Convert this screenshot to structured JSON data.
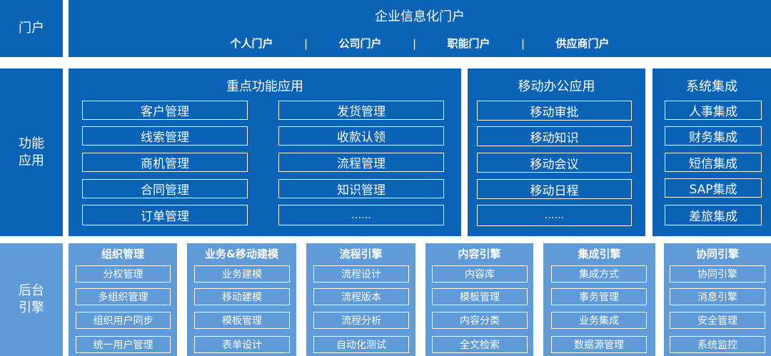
{
  "rows": {
    "portal": "门户",
    "function": "功能\n应用",
    "engine": "后台\n引擎"
  },
  "portal": {
    "title": "企业信息化门户",
    "links": [
      "个人门户",
      "公司门户",
      "职能门户",
      "供应商门户"
    ],
    "separator": "|"
  },
  "key_apps": {
    "title": "重点功能应用",
    "left": [
      "客户管理",
      "线索管理",
      "商机管理",
      "合同管理",
      "订单管理"
    ],
    "right": [
      "发货管理",
      "收款认领",
      "流程管理",
      "知识管理",
      "……"
    ]
  },
  "mobile": {
    "title": "移动办公应用",
    "items": [
      "移动审批",
      "移动知识",
      "移动会议",
      "移动日程",
      "……"
    ]
  },
  "integration": {
    "title": "系统集成",
    "items": [
      "人事集成",
      "财务集成",
      "短信集成",
      "SAP集成",
      "差旅集成"
    ]
  },
  "engines": [
    {
      "title": "组织管理",
      "items": [
        "分权管理",
        "多组织管理",
        "组织用户同步",
        "统一用户管理"
      ]
    },
    {
      "title": "业务&移动建模",
      "items": [
        "业务建模",
        "移动建模",
        "模板管理",
        "表单设计"
      ]
    },
    {
      "title": "流程引擎",
      "items": [
        "流程设计",
        "流程版本",
        "流程分析",
        "自动化测试"
      ]
    },
    {
      "title": "内容引擎",
      "items": [
        "内容库",
        "模板管理",
        "内容分类",
        "全文检索"
      ]
    },
    {
      "title": "集成引擎",
      "items": [
        "集成方式",
        "事务管理",
        "业务集成",
        "数据源管理"
      ]
    },
    {
      "title": "协同引擎",
      "items": [
        "协同引擎",
        "消息引擎",
        "安全管理",
        "系统监控"
      ]
    }
  ],
  "colors": {
    "dark_blue": "#0b63b7",
    "light_blue": "#5f9bd8",
    "border": "#ffffff"
  }
}
